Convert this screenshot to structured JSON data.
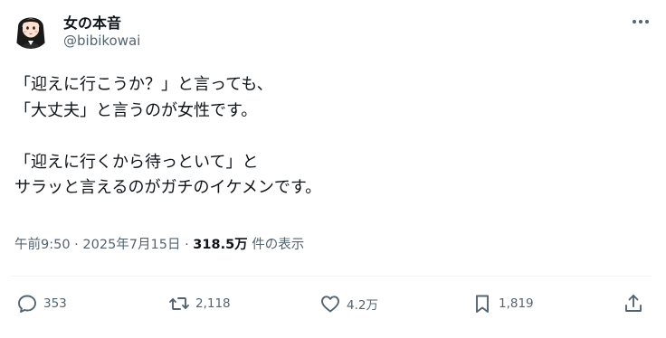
{
  "tweet": {
    "author": {
      "display_name": "女の本音",
      "handle": "@bibikowai"
    },
    "text_lines": [
      "「迎えに行こうか？」と言っても、",
      "「大丈夫」と言うのが女性です。",
      "",
      "「迎えに行くから待っといて」と",
      "サラッと言えるのがガチのイケメンです。"
    ],
    "meta": {
      "timestamp": "午前9:50 · 2025年7月15日 · ",
      "views_count": "318.5万",
      "views_label": " 件の表示"
    },
    "actions": {
      "reply_count": "353",
      "repost_count": "2,118",
      "like_count": "4.2万",
      "bookmark_count": "1,819"
    }
  },
  "colors": {
    "text": "#0f1419",
    "secondary": "#536471",
    "divider": "#eff3f4"
  },
  "icons": [
    "more-icon",
    "reply-icon",
    "repost-icon",
    "like-icon",
    "bookmark-icon",
    "share-icon"
  ]
}
